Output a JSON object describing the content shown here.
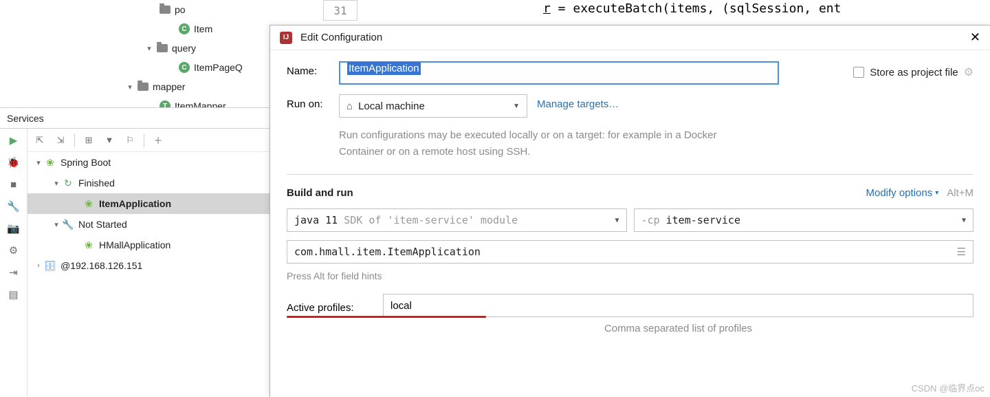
{
  "project_tree": {
    "items": [
      {
        "indent": 232,
        "chevron": "",
        "icon": "folder",
        "label": "po"
      },
      {
        "indent": 260,
        "chevron": "",
        "icon": "c",
        "icon_letter": "C",
        "label": "Item"
      },
      {
        "indent": 210,
        "chevron": "▾",
        "icon": "folder",
        "label": "query"
      },
      {
        "indent": 260,
        "chevron": "",
        "icon": "c",
        "icon_letter": "C",
        "label": "ItemPageQ"
      },
      {
        "indent": 182,
        "chevron": "▾",
        "icon": "folder",
        "label": "mapper"
      },
      {
        "indent": 232,
        "chevron": "",
        "icon": "t",
        "icon_letter": "T",
        "label": "ItemMapper"
      }
    ]
  },
  "editor": {
    "line_number": "31",
    "code": "r = executeBatch(items, (sqlSession, ent"
  },
  "services": {
    "title": "Services",
    "tree": {
      "root": {
        "chev": "▾",
        "label": "Spring Boot"
      },
      "finished": {
        "chev": "▾",
        "label": "Finished"
      },
      "finished_item": {
        "label": "ItemApplication"
      },
      "notstarted": {
        "chev": "▾",
        "label": "Not Started"
      },
      "notstarted_item": {
        "label": "HMallApplication"
      },
      "remote": {
        "chev": "›",
        "label": "@192.168.126.151"
      }
    }
  },
  "dialog": {
    "title": "Edit Configuration",
    "name_label": "Name:",
    "name_value": "ItemApplication",
    "store_label": "Store as project file",
    "runon_label": "Run on:",
    "runon_value": "Local machine",
    "manage_targets": "Manage targets…",
    "runon_hint": "Run configurations may be executed locally or on a target: for example in a Docker Container or on a remote host using SSH.",
    "section_title": "Build and run",
    "modify_options": "Modify options",
    "modify_shortcut": "Alt+M",
    "sdk_prefix": "java 11",
    "sdk_suffix": "SDK of 'item-service' module",
    "cp_prefix": "-cp",
    "cp_value": "item-service",
    "main_class": "com.hmall.item.ItemApplication",
    "field_hint": "Press Alt for field hints",
    "profiles_label": "Active profiles:",
    "profiles_value": "local",
    "profiles_hint": "Comma separated list of profiles"
  },
  "watermark": "CSDN @临界点oc"
}
